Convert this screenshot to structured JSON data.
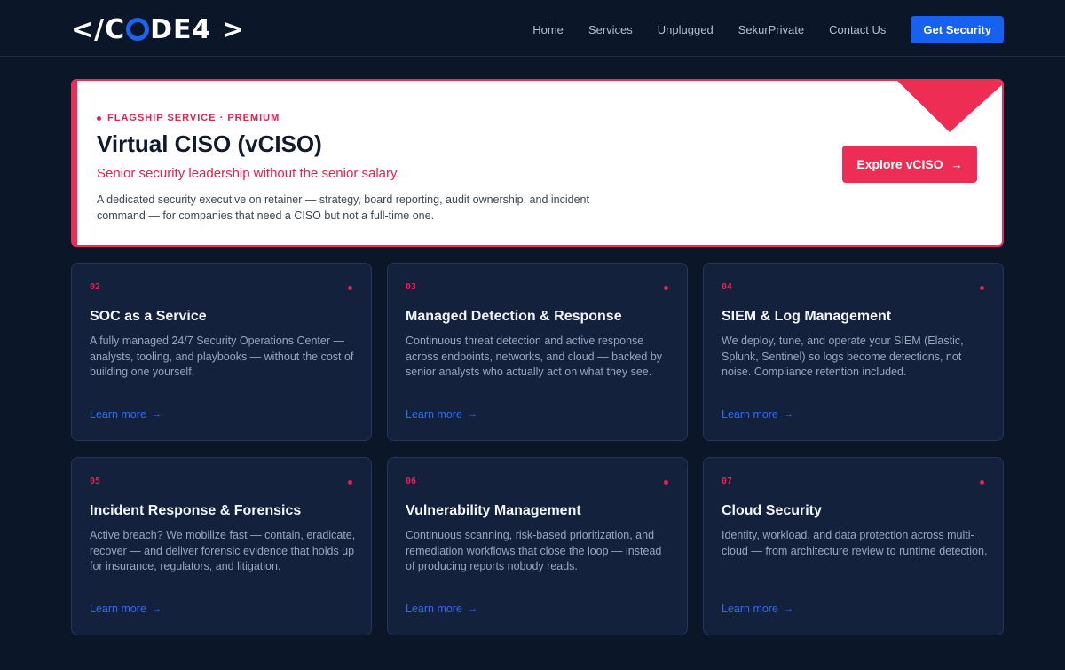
{
  "header": {
    "logo": {
      "prefix": "</C",
      "suffix": "DE4 >"
    },
    "nav": [
      "Home",
      "Services",
      "Unplugged",
      "SekurPrivate",
      "Contact Us"
    ],
    "cta": "Get Security"
  },
  "featured": {
    "tag": "FLAGSHIP SERVICE · PREMIUM",
    "title": "Virtual CISO (vCISO)",
    "subtitle": "Senior security leadership without the senior salary.",
    "description": "A dedicated security executive on retainer — strategy, board reporting, audit ownership, and incident command — for companies that need a CISO but not a full-time one.",
    "button": "Explore vCISO",
    "button_icon": "arrow-right-icon"
  },
  "cards": [
    {
      "num": "02",
      "title": "SOC as a Service",
      "desc": "A fully managed 24/7 Security Operations Center — analysts, tooling, and playbooks — without the cost of building one yourself.",
      "link": "Learn more"
    },
    {
      "num": "03",
      "title": "Managed Detection & Response",
      "desc": "Continuous threat detection and active response across endpoints, networks, and cloud — backed by senior analysts who actually act on what they see.",
      "link": "Learn more"
    },
    {
      "num": "04",
      "title": "SIEM & Log Management",
      "desc": "We deploy, tune, and operate your SIEM (Elastic, Splunk, Sentinel) so logs become detections, not noise. Compliance retention included.",
      "link": "Learn more"
    },
    {
      "num": "05",
      "title": "Incident Response & Forensics",
      "desc": "Active breach? We mobilize fast — contain, eradicate, recover — and deliver forensic evidence that holds up for insurance, regulators, and litigation.",
      "link": "Learn more"
    },
    {
      "num": "06",
      "title": "Vulnerability Management",
      "desc": "Continuous scanning, risk-based prioritization, and remediation workflows that close the loop — instead of producing reports nobody reads.",
      "link": "Learn more"
    },
    {
      "num": "07",
      "title": "Cloud Security",
      "desc": "Identity, workload, and data protection across multi-cloud — from architecture review to runtime detection.",
      "link": "Learn more"
    }
  ],
  "colors": {
    "background": "#0c1629",
    "accent_red": "#ee2d55",
    "accent_blue": "#1761ef",
    "card_bg": "#14213d"
  }
}
